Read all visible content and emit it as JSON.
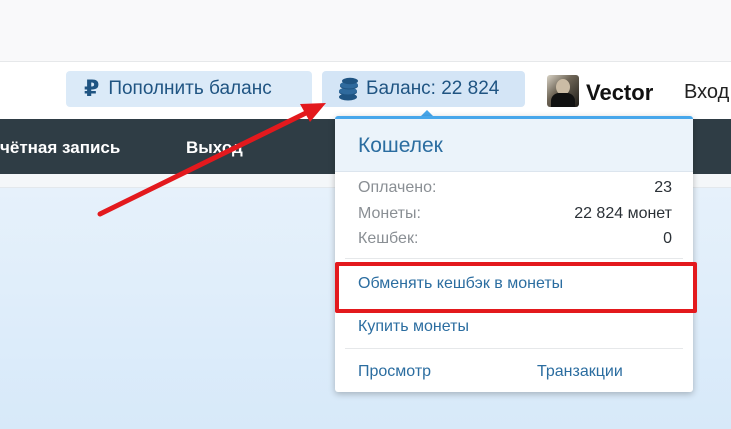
{
  "header": {
    "topup_label": "Пополнить баланс",
    "ruble_icon": "₽",
    "balance_label": "Баланс: 22 824",
    "username": "Vector",
    "login_label": "Вход"
  },
  "nav": {
    "account_label": "чётная запись",
    "logout_label": "Выход"
  },
  "wallet": {
    "title": "Кошелек",
    "rows": [
      {
        "label": "Оплачено:",
        "value": "23"
      },
      {
        "label": "Монеты:",
        "value": "22 824 монет"
      },
      {
        "label": "Кешбек:",
        "value": "0"
      }
    ],
    "exchange_label": "Обменять кешбэк в монеты",
    "buy_label": "Купить монеты",
    "view_label": "Просмотр",
    "transactions_label": "Транзакции"
  },
  "colors": {
    "accent": "#47a7eb",
    "nav_bg": "#2f3d45",
    "highlight": "#e3191d",
    "link": "#2b6da0"
  }
}
